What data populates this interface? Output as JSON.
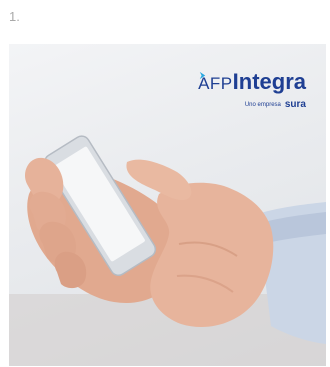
{
  "step": {
    "number_label": "1."
  },
  "logo": {
    "prefix": "AFP",
    "brand": "Integra",
    "tagline": "Uno empresa",
    "partner": "sura"
  },
  "colors": {
    "brand_blue": "#1f3f93",
    "accent_cyan": "#29a8e0"
  },
  "icons": {
    "partner_mark": "arrow-icon"
  }
}
